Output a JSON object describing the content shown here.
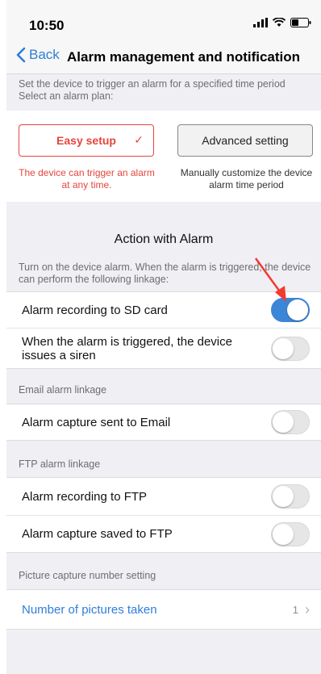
{
  "status_bar": {
    "time": "10:50"
  },
  "nav": {
    "back_label": "Back",
    "title": "Alarm management and notification"
  },
  "alarm_plan": {
    "intro_line1": "Set the device to trigger an alarm for a specified time period",
    "intro_line2": "Select an alarm plan:",
    "easy_setup_label": "Easy setup",
    "easy_setup_check": "✓",
    "easy_setup_desc": "The device can trigger an alarm at any time.",
    "advanced_label": "Advanced setting",
    "advanced_desc": "Manually customize the device alarm time period",
    "selected": "Easy setup"
  },
  "action_section": {
    "heading": "Action with Alarm",
    "note": "Turn on the device alarm. When the alarm is triggered, the device can perform the following linkage:",
    "items": [
      {
        "label": "Alarm recording to SD card",
        "enabled": true
      },
      {
        "label": "When the alarm is triggered, the device issues a siren",
        "enabled": false
      }
    ]
  },
  "email_section": {
    "header": "Email alarm linkage",
    "items": [
      {
        "label": "Alarm capture sent to Email",
        "enabled": false
      }
    ]
  },
  "ftp_section": {
    "header": "FTP alarm linkage",
    "items": [
      {
        "label": "Alarm recording to FTP",
        "enabled": false
      },
      {
        "label": "Alarm capture saved to FTP",
        "enabled": false
      }
    ]
  },
  "capture_section": {
    "header": "Picture capture number setting",
    "item_label": "Number of pictures taken",
    "item_value": "1",
    "chevron": "›"
  },
  "colors": {
    "accent_blue": "#3c86d8",
    "link_blue": "#2f7ed8",
    "alert_red": "#e5453d"
  }
}
